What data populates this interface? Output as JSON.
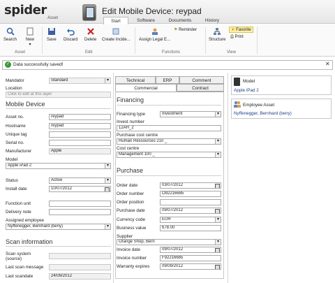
{
  "app": {
    "logo": "spider",
    "logo_sub": "Asset",
    "window_title": "Edit Mobile Device: reypad"
  },
  "tabs": [
    "Start",
    "Software",
    "Documents",
    "History"
  ],
  "ribbon": {
    "search": "Search",
    "new": "New",
    "save": "Save",
    "discard": "Discard",
    "delete": "Delete",
    "create_incident": "Create Incide...",
    "assign_legal": "Assign Legal E...",
    "reminder": "Reminder",
    "structure": "Structure",
    "favorite": "Favorite",
    "print": "Print",
    "groups": {
      "asset": "Asset",
      "edit": "Edit",
      "functions": "Functions",
      "view": "View"
    }
  },
  "message": "Data successfully saved!",
  "left": {
    "mandator_label": "Mandator",
    "mandator_value": "Standard",
    "location_label": "Location",
    "location_value": "Click to edit at this layer",
    "section_mobile": "Mobile Device",
    "asset_no_label": "Asset no.",
    "asset_no": "reypad",
    "hostname_label": "Hostname",
    "hostname": "reypad",
    "unique_tag_label": "Unique tag",
    "unique_tag": "",
    "serial_label": "Serial no.",
    "serial": "",
    "manufacturer_label": "Manufacturer",
    "manufacturer": "Apple",
    "model_label": "Model",
    "model": "Apple iPad 2",
    "status_label": "Status",
    "status": "Active",
    "install_date_label": "Install date",
    "install_date": "10/07/2012",
    "function_unit_label": "Function unit",
    "function_unit": "",
    "delivery_note_label": "Delivery note",
    "delivery_note": "",
    "assigned_label": "Assigned employee",
    "assigned": "Nyffenegger, Bernhard (beny)",
    "section_scan": "Scan information",
    "scan_system_label": "Scan system",
    "scan_system_sub": "(source)",
    "scan_system": "",
    "last_scan_msg_label": "Last scan message",
    "last_scan_msg": "",
    "last_scandate_label": "Last scandate",
    "last_scandate": "24/09/2012"
  },
  "middle": {
    "tabs_row1": [
      "Technical",
      "ERP",
      "Comment"
    ],
    "tabs_row2": [
      "Commercial",
      "Contract"
    ],
    "section_financing": "Financing",
    "financing_type_label": "Financing type",
    "financing_type": "Investment",
    "invest_number_label": "Invest number",
    "invest_number": "12AH_2",
    "purchase_cc_label": "Purchase cost centre",
    "purchase_cc": "Human Ressources 210 _",
    "cost_centre_label": "Cost centre",
    "cost_centre": "Management 100 _",
    "section_purchase": "Purchase",
    "order_date_label": "Order date",
    "order_date": "03/07/2012",
    "order_number_label": "Order number",
    "order_number": "O92216685",
    "order_position_label": "Order position",
    "order_position": "",
    "purchase_date_label": "Purchase date",
    "purchase_date": "09/07/2012",
    "currency_label": "Currency code",
    "currency": "EUR",
    "business_value_label": "Business value",
    "business_value": "678.00",
    "supplier_label": "Supplier",
    "supplier": "Orange Shop, Bern",
    "invoice_date_label": "Invoice date",
    "invoice_date": "09/07/2012",
    "invoice_number_label": "Invoice number",
    "invoice_number": "F92216685",
    "warranty_label": "Warranty expires",
    "warranty": "09/09/2012"
  },
  "right": {
    "model_label": "Model",
    "model_value": "Apple iPad 2",
    "employee_label": "Employee Asset",
    "employee_value": "Nyffenegger, Bernhard (beny)"
  }
}
